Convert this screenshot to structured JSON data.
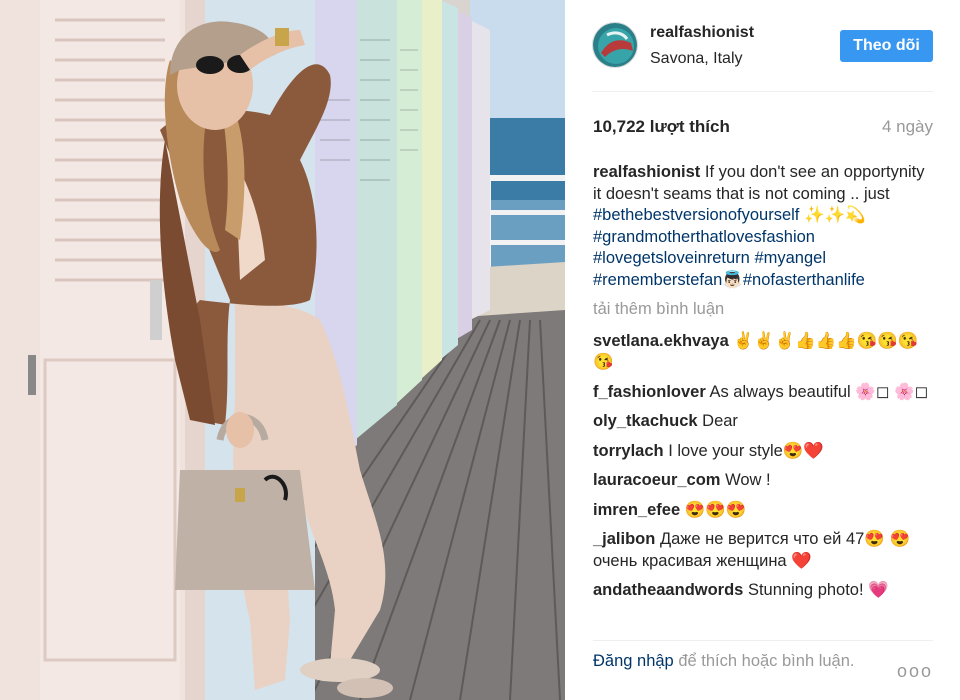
{
  "post": {
    "username": "realfashionist",
    "location": "Savona, Italy",
    "follow_label": "Theo dõi",
    "likes": "10,722 lượt thích",
    "time_ago": "4 ngày"
  },
  "caption": {
    "username": "realfashionist",
    "text": "If you don't see an opportynity it doesn't seams that is not coming .. just",
    "tags": [
      "#bethebestversionofyourself",
      "#grandmotherthatlovesfashion",
      "#lovegetsloveinreturn",
      "#myangel",
      "#rememberstefan",
      "#nofasterthanlife"
    ],
    "emoji_after_tag0": "✨✨💫",
    "emoji_after_tag4": "👼🏻"
  },
  "load_more": "tải thêm bình luận",
  "comments": [
    {
      "username": "svetlana.ekhvaya",
      "text": "✌️✌️✌️👍👍👍😘😘😘😘"
    },
    {
      "username": "f_fashionlover",
      "text": "As always beautiful 🌸◻ 🌸◻"
    },
    {
      "username": "oly_tkachuck",
      "text": "Dear"
    },
    {
      "username": "torrylach",
      "text": "I love your style😍❤️"
    },
    {
      "username": "lauracoeur_com",
      "text": "Wow !"
    },
    {
      "username": "imren_efee",
      "text": "😍😍😍"
    },
    {
      "username": "_jalibon",
      "text": "Даже не верится что ей 47😍 😍 очень красивая женщина ❤️"
    },
    {
      "username": "andatheaandwords",
      "text": "Stunning photo! 💗"
    }
  ],
  "footer": {
    "login_link": "Đăng nhập",
    "login_rest": "để thích hoặc bình luận.",
    "more": "ooo"
  },
  "colors": {
    "accent": "#3897f0",
    "hashtag": "#003569",
    "muted": "#999999"
  }
}
